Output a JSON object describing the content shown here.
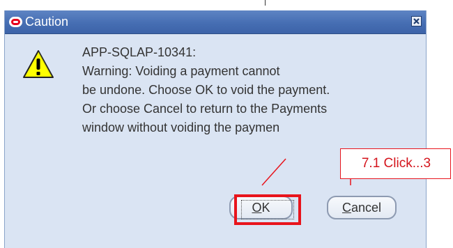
{
  "dialog": {
    "title": "Caution",
    "close_label": "Close"
  },
  "message": {
    "code": "APP-SQLAP-10341:",
    "lines": [
      "Warning: Voiding a payment cannot",
      "be undone. Choose OK to void the payment.",
      "Or choose Cancel to return to the Payments",
      "window without voiding the paymen"
    ]
  },
  "buttons": {
    "ok": {
      "accel": "O",
      "rest": "K"
    },
    "cancel": {
      "accel": "C",
      "rest": "ancel"
    }
  },
  "annotation": {
    "callout_text": "7.1 Click...3"
  },
  "colors": {
    "titlebar": "#466eb3",
    "dialog_bg": "#dae4f3",
    "highlight": "#e8141c"
  }
}
